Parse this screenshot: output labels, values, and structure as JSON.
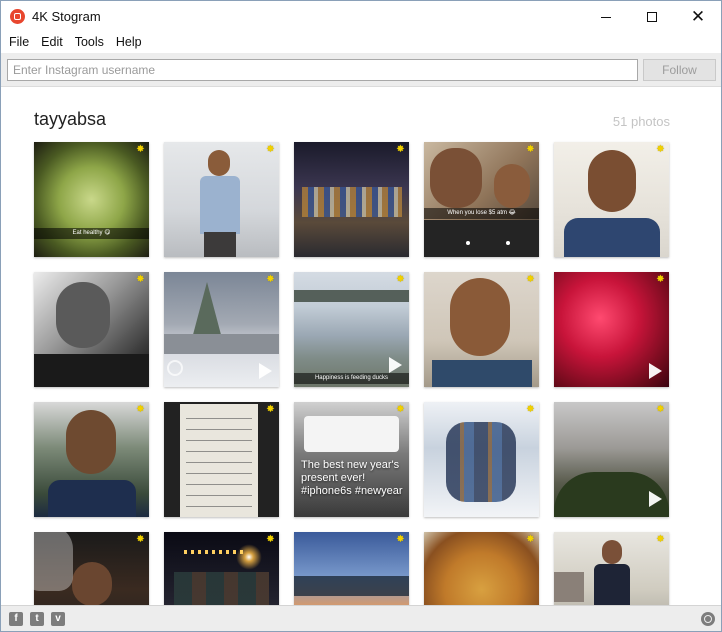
{
  "window": {
    "title": "4K Stogram",
    "minimize": "",
    "maximize": "",
    "close": "✕"
  },
  "menu": [
    "File",
    "Edit",
    "Tools",
    "Help"
  ],
  "search": {
    "placeholder": "Enter Instagram username",
    "value": "",
    "follow_label": "Follow"
  },
  "profile": {
    "username": "tayyabsa",
    "photo_count": "51 photos"
  },
  "photos": [
    {
      "name": "photo-salad",
      "caption": "Eat healthy 😋",
      "video": false
    },
    {
      "name": "photo-man-standing",
      "caption": "",
      "video": false
    },
    {
      "name": "photo-casino",
      "caption": "",
      "video": false
    },
    {
      "name": "photo-selfie-two-men",
      "caption": "When you lose $5 atm 😂",
      "video": false
    },
    {
      "name": "photo-selfie-indoor",
      "caption": "",
      "video": false
    },
    {
      "name": "photo-car-selfie-bw",
      "caption": "",
      "video": false
    },
    {
      "name": "photo-snowy-tree",
      "caption": "",
      "video": true
    },
    {
      "name": "photo-lake-ducks",
      "caption": "Happiness is feeding ducks",
      "video": true
    },
    {
      "name": "photo-selfie-closeup",
      "caption": "",
      "video": false
    },
    {
      "name": "photo-red-fabric",
      "caption": "",
      "video": true
    },
    {
      "name": "photo-selfie-outdoor",
      "caption": "",
      "video": false
    },
    {
      "name": "photo-quran-text",
      "caption": "",
      "video": false
    },
    {
      "name": "photo-iphone-box",
      "caption": "The best new year's present ever! #iphone6s #newyear",
      "video": false
    },
    {
      "name": "photo-group-snow",
      "caption": "",
      "video": false
    },
    {
      "name": "photo-winter-garden",
      "caption": "",
      "video": true
    },
    {
      "name": "photo-man-dark",
      "caption": "",
      "video": false
    },
    {
      "name": "photo-fireworks-group",
      "caption": "",
      "video": false
    },
    {
      "name": "photo-sunset-trees",
      "caption": "",
      "video": false
    },
    {
      "name": "photo-biryani",
      "caption": "",
      "video": false
    },
    {
      "name": "photo-man-suit",
      "caption": "",
      "video": false
    }
  ],
  "social": {
    "facebook": "f",
    "twitter": "t",
    "vimeo": "v"
  },
  "colors": {
    "accent_star": "#f2d100",
    "follow_disabled": "#9c9c9c"
  }
}
